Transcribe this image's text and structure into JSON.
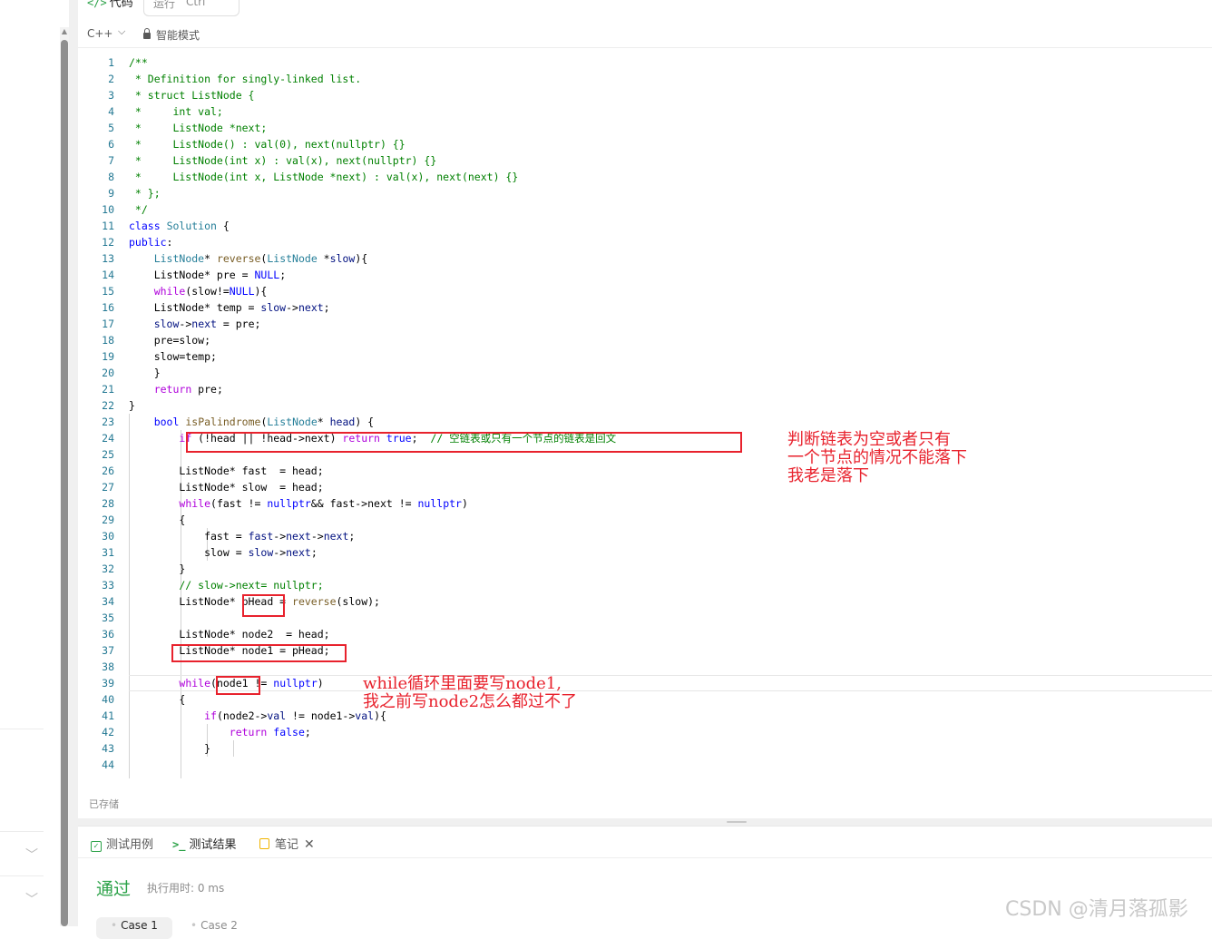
{
  "panel": {
    "tab_code_icon": "</>",
    "tab_code": "代码",
    "run_label": "运行",
    "run_shortcut": "Ctrl",
    "language": "C++",
    "language_chevron": "⌵",
    "smart_mode": "智能模式",
    "saved_status": "已存储"
  },
  "code_lines": [
    {
      "n": "1"
    },
    {
      "n": "2"
    },
    {
      "n": "3"
    },
    {
      "n": "4"
    },
    {
      "n": "5"
    },
    {
      "n": "6"
    },
    {
      "n": "7"
    },
    {
      "n": "8"
    },
    {
      "n": "9"
    },
    {
      "n": "10"
    },
    {
      "n": "11"
    },
    {
      "n": "12"
    },
    {
      "n": "13"
    },
    {
      "n": "14"
    },
    {
      "n": "15"
    },
    {
      "n": "16"
    },
    {
      "n": "17"
    },
    {
      "n": "18"
    },
    {
      "n": "19"
    },
    {
      "n": "20"
    },
    {
      "n": "21"
    },
    {
      "n": "22"
    },
    {
      "n": "23"
    },
    {
      "n": "24"
    },
    {
      "n": "25"
    },
    {
      "n": "26"
    },
    {
      "n": "27"
    },
    {
      "n": "28"
    },
    {
      "n": "29"
    },
    {
      "n": "30"
    },
    {
      "n": "31"
    },
    {
      "n": "32"
    },
    {
      "n": "33"
    },
    {
      "n": "34"
    },
    {
      "n": "35"
    },
    {
      "n": "36"
    },
    {
      "n": "37"
    },
    {
      "n": "38"
    },
    {
      "n": "39"
    },
    {
      "n": "40"
    },
    {
      "n": "41"
    },
    {
      "n": "42"
    },
    {
      "n": "43"
    },
    {
      "n": "44"
    }
  ],
  "code": {
    "l1": "/**",
    "l2": " * Definition for singly-linked list.",
    "l3": " * struct ListNode {",
    "l4": " *     int val;",
    "l5": " *     ListNode *next;",
    "l6": " *     ListNode() : val(0), next(nullptr) {}",
    "l7": " *     ListNode(int x) : val(x), next(nullptr) {}",
    "l8": " *     ListNode(int x, ListNode *next) : val(x), next(next) {}",
    "l9": " * };",
    "l10": " */",
    "l11": [
      "class",
      " ",
      "Solution",
      " {"
    ],
    "l12": [
      "public",
      ":"
    ],
    "l13": [
      "    ",
      "ListNode",
      "* ",
      "reverse",
      "(",
      "ListNode",
      " *",
      "slow",
      "){"
    ],
    "l14": [
      "    ListNode* pre = ",
      "NULL",
      ";"
    ],
    "l15": [
      "    ",
      "while",
      "(slow!=",
      "NULL",
      "){"
    ],
    "l16": [
      "    ListNode* temp = ",
      "slow",
      "->",
      "next",
      ";"
    ],
    "l17": [
      "    ",
      "slow",
      "->",
      "next",
      " = pre;"
    ],
    "l18": "    pre=slow;",
    "l19": "    slow=temp;",
    "l20": "    }",
    "l21": [
      "    ",
      "return",
      " pre;"
    ],
    "l22": "}",
    "l23": [
      "    ",
      "bool",
      " ",
      "isPalindrome",
      "(",
      "ListNode",
      "* ",
      "head",
      ") {"
    ],
    "l24": [
      "        ",
      "if",
      " (!head || !head->next) ",
      "return",
      " ",
      "true",
      ";  ",
      "// 空链表或只有一个节点的链表是回文"
    ],
    "l25": "",
    "l26": "        ListNode* fast  = head;",
    "l27": "        ListNode* slow  = head;",
    "l28": [
      "        ",
      "while",
      "(fast != ",
      "nullptr",
      "&& fast->next != ",
      "nullptr",
      ")"
    ],
    "l29": "        {",
    "l30": [
      "            fast = ",
      "fast",
      "->",
      "next",
      "->",
      "next",
      ";"
    ],
    "l31": [
      "            slow = ",
      "slow",
      "->",
      "next",
      ";"
    ],
    "l32": "        }",
    "l33": "        // slow->next= nullptr;",
    "l34": [
      "        ListNode* ",
      "pHead",
      " = ",
      "reverse",
      "(slow);"
    ],
    "l35": "",
    "l36": "        ListNode* node2  = head;",
    "l37": "        ListNode* node1 = pHead;",
    "l38": "",
    "l39": [
      "        ",
      "while",
      "(",
      "node1",
      " != ",
      "nullptr",
      ")"
    ],
    "l40": "        {",
    "l41": [
      "            ",
      "if",
      "(node2->",
      "val",
      " != node1->",
      "val",
      "){"
    ],
    "l42": [
      "                ",
      "return",
      " ",
      "false",
      ";"
    ],
    "l43": "            }",
    "l44": ""
  },
  "annotations": {
    "note1": "判断链表为空或者只有\n一个节点的情况不能落下\n我老是落下",
    "note2": "while循环里面要写node1,\n我之前写node2怎么都过不了"
  },
  "bottom": {
    "tab_testcase": "测试用例",
    "tab_result_icon": ">_",
    "tab_result": "测试结果",
    "tab_notes": "笔记",
    "close": "✕",
    "status": "通过",
    "exec_time": "执行用时: 0 ms",
    "case1": "Case 1",
    "case2": "Case 2"
  },
  "watermark": "CSDN @清月落孤影",
  "colors": {
    "accent_green": "#2aa147",
    "annotation_red": "#e8222d"
  }
}
